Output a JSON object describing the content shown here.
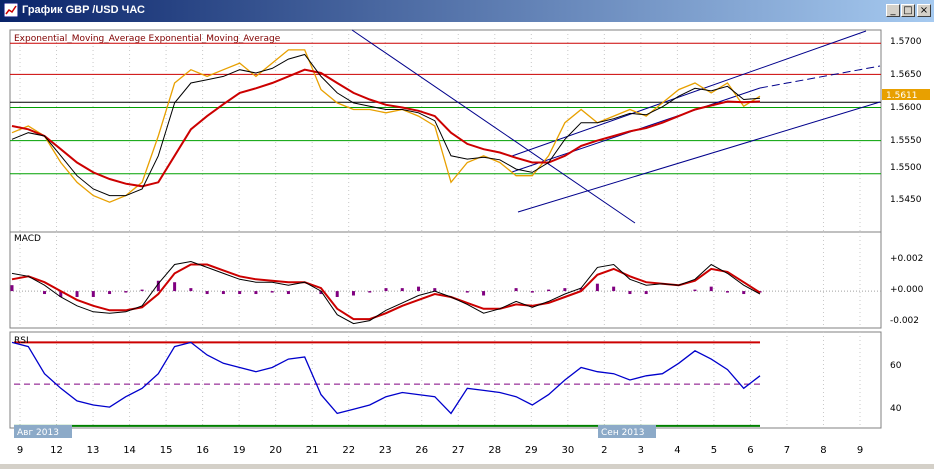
{
  "window": {
    "title": "График GBP /USD  ЧАС",
    "minimize_glyph": "_",
    "maximize_glyph": "□",
    "close_glyph": "×"
  },
  "colors": {
    "title_gradient_start": "#0a246a",
    "price_line": "#e8a000",
    "ema_fast": "#000000",
    "ema_slow": "#cc0000",
    "channel": "#00008b",
    "resistance": "#cc0000",
    "support": "#00a000",
    "current_price_tag": "#e8a000",
    "rsi_line": "#0000cc",
    "macd_histogram": "#800080"
  },
  "main_panel": {
    "legend": "Exponential_Moving_Average Exponential_Moving_Average",
    "price_ticks": [
      "1.5700",
      "1.5650",
      "1.5600",
      "1.5550",
      "1.5500",
      "1.5450"
    ],
    "current_price": "1.5611"
  },
  "macd_panel": {
    "label": "MACD",
    "ticks": [
      "+0.002",
      "+0.000",
      "-0.002"
    ]
  },
  "rsi_panel": {
    "label": "RSI",
    "ticks": [
      "60",
      "40"
    ]
  },
  "x_axis": {
    "day_labels": [
      "9",
      "12",
      "13",
      "14",
      "15",
      "16",
      "19",
      "20",
      "21",
      "22",
      "23",
      "26",
      "27",
      "28",
      "29",
      "30",
      "2",
      "3",
      "4",
      "5",
      "6",
      "7",
      "8",
      "9"
    ],
    "month_start_label": "Авг 2013",
    "month_change_label": "Сен 2013"
  },
  "chart_data": [
    {
      "type": "line",
      "title": "",
      "series": [
        {
          "values": [
            1.5565,
            1.5575,
            1.556,
            1.552,
            1.549,
            1.547,
            1.546,
            1.547,
            1.549,
            1.556,
            1.564,
            1.566,
            1.565,
            1.566,
            1.567,
            1.565,
            1.567,
            1.569,
            1.569,
            1.563,
            1.561,
            1.56,
            1.56,
            1.5595,
            1.56,
            1.559,
            1.5575,
            1.549,
            1.552,
            1.553,
            1.552,
            1.55,
            1.55,
            1.553,
            1.558,
            1.56,
            1.558,
            1.559,
            1.56,
            1.559,
            1.561,
            1.563,
            1.564,
            1.5625,
            1.564,
            1.5605,
            1.562
          ]
        },
        {
          "name": "Exponential_Moving_Average",
          "values": [
            1.5555,
            1.5565,
            1.556,
            1.553,
            1.55,
            1.548,
            1.547,
            1.547,
            1.548,
            1.553,
            1.561,
            1.564,
            1.5645,
            1.565,
            1.566,
            1.5655,
            1.5662,
            1.5676,
            1.5683,
            1.565,
            1.5625,
            1.561,
            1.5605,
            1.56,
            1.56,
            1.5595,
            1.5583,
            1.553,
            1.5525,
            1.5528,
            1.5524,
            1.551,
            1.5505,
            1.552,
            1.5555,
            1.558,
            1.558,
            1.5586,
            1.5594,
            1.5592,
            1.5604,
            1.562,
            1.5632,
            1.5628,
            1.5635,
            1.5615,
            1.5617
          ]
        },
        {
          "name": "Exponential_Moving_Average",
          "values": [
            1.5575,
            1.557,
            1.556,
            1.554,
            1.552,
            1.5505,
            1.5495,
            1.5488,
            1.5484,
            1.549,
            1.553,
            1.557,
            1.559,
            1.5608,
            1.5625,
            1.5632,
            1.564,
            1.565,
            1.566,
            1.5655,
            1.564,
            1.5625,
            1.5615,
            1.5607,
            1.5603,
            1.5598,
            1.559,
            1.5565,
            1.5548,
            1.554,
            1.5535,
            1.5527,
            1.552,
            1.552,
            1.553,
            1.5545,
            1.5553,
            1.556,
            1.5567,
            1.5572,
            1.558,
            1.559,
            1.56,
            1.5606,
            1.5612,
            1.5611,
            1.5612
          ]
        }
      ],
      "ylim": [
        1.5415,
        1.572
      ],
      "hlines": [
        1.57,
        1.5653,
        1.5611,
        1.5603,
        1.5553,
        1.5503
      ]
    },
    {
      "type": "line",
      "series": [
        {
          "values": [
            0.0012,
            0.001,
            0.0004,
            -0.0004,
            -0.001,
            -0.0014,
            -0.0015,
            -0.0014,
            -0.001,
            0.0005,
            0.0018,
            0.002,
            0.0016,
            0.0012,
            0.0008,
            0.0006,
            0.0006,
            0.0004,
            0.0006,
            0.0,
            -0.0016,
            -0.0022,
            -0.002,
            -0.0013,
            -0.0008,
            -0.0003,
            0.0,
            -0.0004,
            -0.0009,
            -0.0015,
            -0.0012,
            -0.0007,
            -0.0011,
            -0.0007,
            -0.0002,
            0.0002,
            0.0016,
            0.0018,
            0.0008,
            0.0004,
            0.0005,
            0.0004,
            0.0008,
            0.0018,
            0.0012,
            0.0004,
            -0.0002
          ]
        },
        {
          "values": [
            0.0008,
            0.001,
            0.0006,
            0.0,
            -0.0006,
            -0.001,
            -0.0013,
            -0.0013,
            -0.0011,
            -0.0002,
            0.0012,
            0.0018,
            0.0018,
            0.0014,
            0.001,
            0.0008,
            0.0007,
            0.0006,
            0.0006,
            0.0002,
            -0.0012,
            -0.0019,
            -0.0019,
            -0.0015,
            -0.001,
            -0.0006,
            -0.0002,
            -0.0004,
            -0.0008,
            -0.0012,
            -0.0012,
            -0.0009,
            -0.001,
            -0.0008,
            -0.0004,
            0.0,
            0.0011,
            0.0015,
            0.001,
            0.0006,
            0.0005,
            0.0004,
            0.0007,
            0.0015,
            0.0013,
            0.0006,
            -0.0001
          ]
        }
      ],
      "histogram": [
        0.0004,
        0.0,
        -0.0002,
        -0.0004,
        -0.0004,
        -0.0004,
        -0.0002,
        -0.0001,
        0.0001,
        0.0007,
        0.0006,
        0.0002,
        -0.0002,
        -0.0002,
        -0.0002,
        -0.0002,
        -0.0001,
        -0.0002,
        0.0,
        -0.0002,
        -0.0004,
        -0.0003,
        -0.0001,
        0.0002,
        0.0002,
        0.0003,
        0.0002,
        0.0,
        -0.0001,
        -0.0003,
        0.0,
        0.0002,
        -0.0001,
        0.0001,
        0.0002,
        0.0002,
        0.0005,
        0.0003,
        -0.0002,
        -0.0002,
        0.0,
        0.0,
        0.0001,
        0.0003,
        -0.0001,
        -0.0002,
        -0.0001
      ],
      "ylim": [
        -0.0025,
        0.004
      ]
    },
    {
      "type": "line",
      "series": [
        {
          "values": [
            70,
            68,
            55,
            48,
            42,
            40,
            39,
            44,
            48,
            55,
            68,
            70,
            64,
            60,
            58,
            56,
            58,
            62,
            63,
            45,
            36,
            38,
            40,
            44,
            46,
            45,
            44,
            36,
            48,
            47,
            46,
            44,
            40,
            45,
            52,
            58,
            56,
            55,
            52,
            54,
            55,
            60,
            66,
            62,
            57,
            48,
            54
          ]
        }
      ],
      "ylim": [
        29,
        75
      ],
      "hlines": [
        70,
        50,
        30
      ]
    }
  ]
}
